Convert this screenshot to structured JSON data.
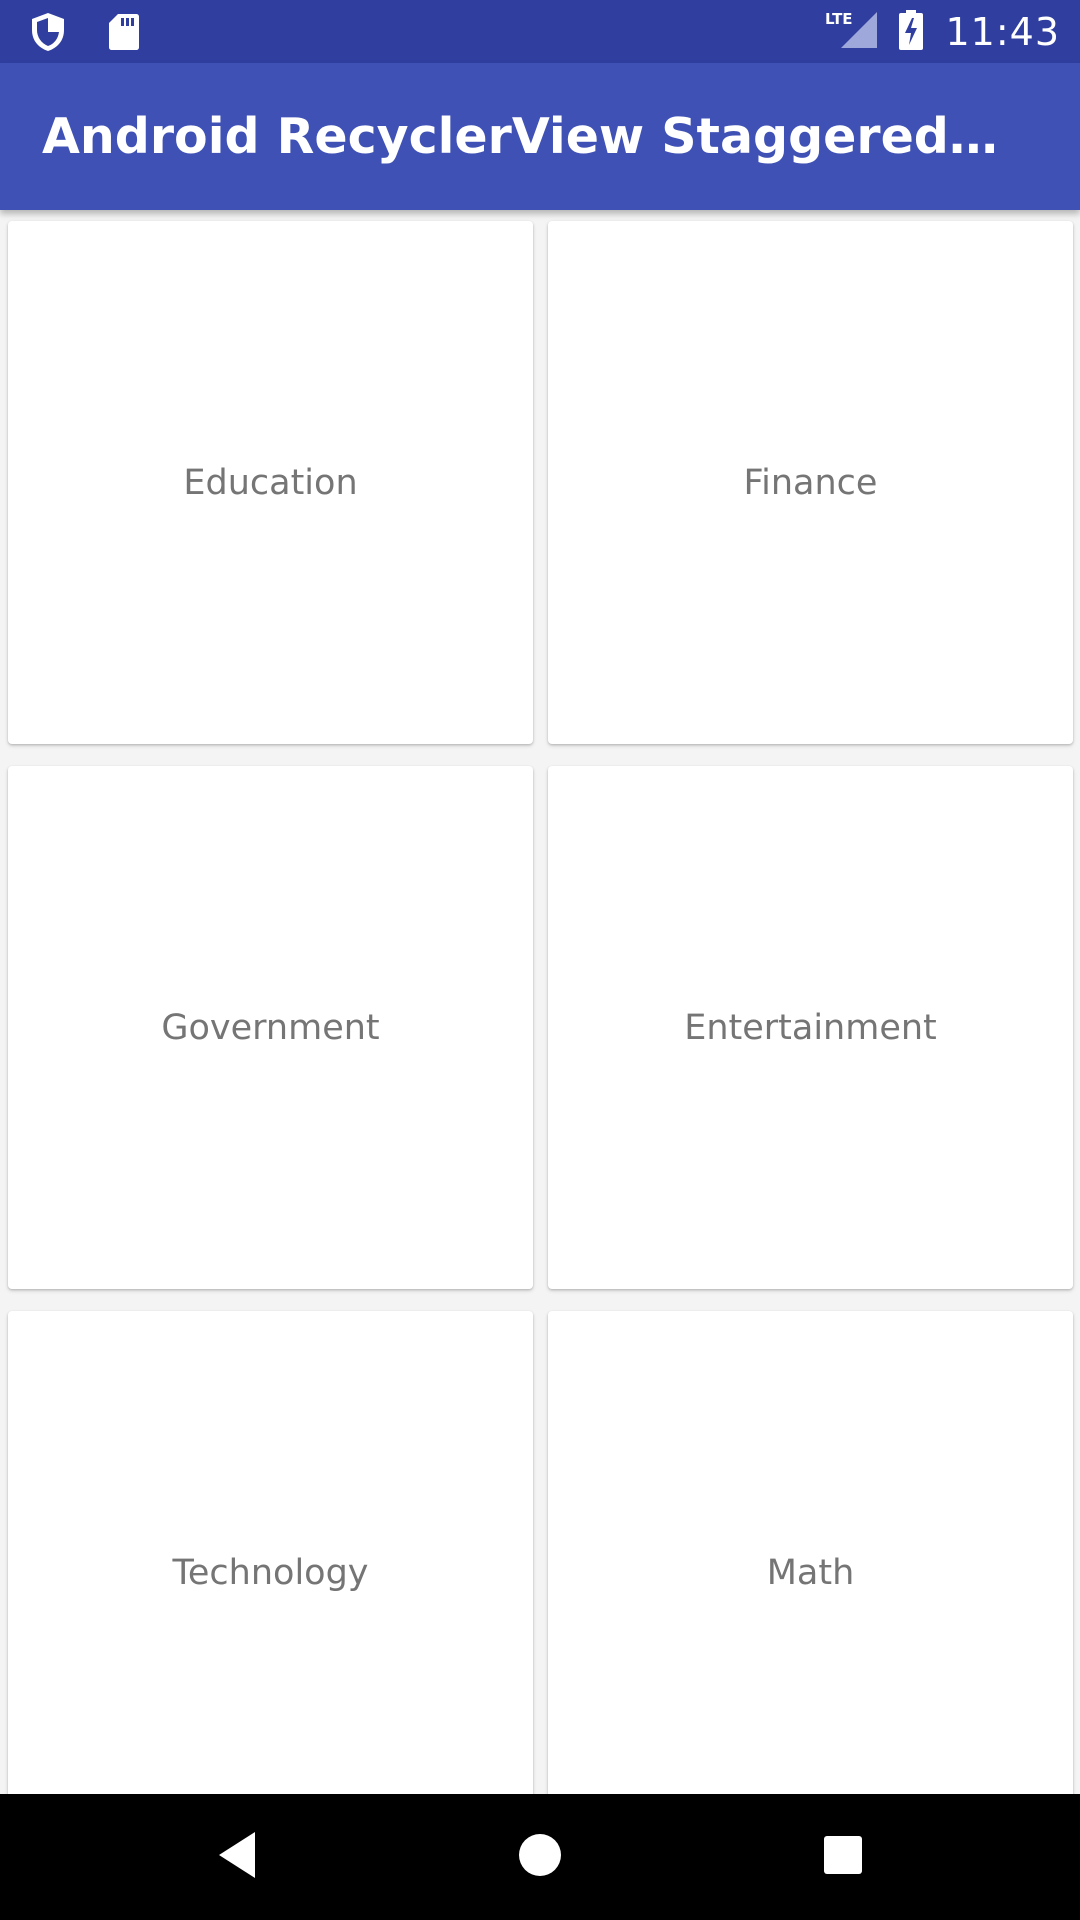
{
  "status_bar": {
    "time": "11:43",
    "network": "LTE",
    "icons": [
      "shield-icon",
      "sd-card-icon",
      "lte-signal-icon",
      "battery-charging-icon"
    ],
    "background": "#303f9f"
  },
  "app_bar": {
    "title": "Android RecyclerView StaggeredGridLa…",
    "background": "#3f51b5"
  },
  "grid": {
    "items": [
      {
        "label": "Education"
      },
      {
        "label": "Finance"
      },
      {
        "label": "Government"
      },
      {
        "label": "Entertainment"
      },
      {
        "label": "Technology"
      },
      {
        "label": "Math"
      }
    ]
  },
  "nav_bar": {
    "buttons": [
      "back-icon",
      "home-icon",
      "recents-icon"
    ]
  }
}
